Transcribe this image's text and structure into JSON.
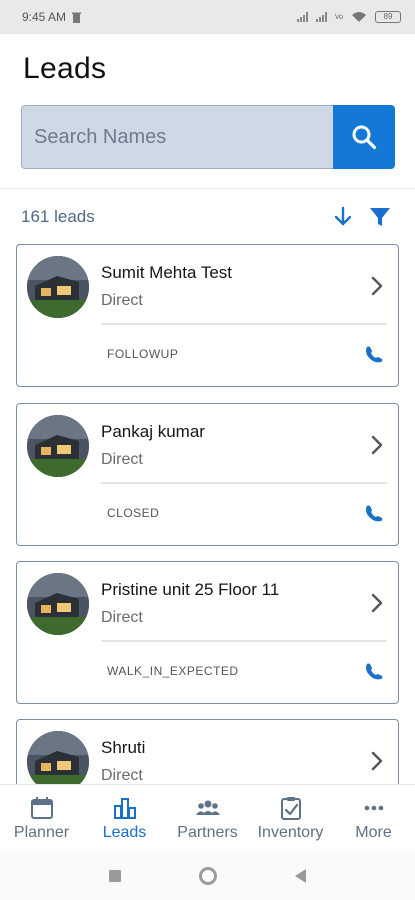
{
  "status_bar": {
    "time": "9:45 AM",
    "network_label": "Vo",
    "battery": "89"
  },
  "header": {
    "title": "Leads"
  },
  "search": {
    "placeholder": "Search Names",
    "icon": "search-icon"
  },
  "toolbar": {
    "lead_count": "161 leads",
    "sort_icon": "sort-down-arrow-icon",
    "filter_icon": "filter-funnel-icon"
  },
  "leads": [
    {
      "name": "Sumit Mehta Test",
      "source": "Direct",
      "status": "FOLLOWUP"
    },
    {
      "name": "Pankaj kumar",
      "source": "Direct",
      "status": "CLOSED"
    },
    {
      "name": "Pristine unit 25 Floor 11",
      "source": "Direct",
      "status": "WALK_IN_EXPECTED"
    },
    {
      "name": "Shruti",
      "source": "Direct",
      "status": ""
    }
  ],
  "bottom_nav": [
    {
      "label": "Planner",
      "icon": "calendar-icon",
      "active": false
    },
    {
      "label": "Leads",
      "icon": "bar-chart-icon",
      "active": true
    },
    {
      "label": "Partners",
      "icon": "group-icon",
      "active": false
    },
    {
      "label": "Inventory",
      "icon": "clipboard-check-icon",
      "active": false
    },
    {
      "label": "More",
      "icon": "more-dots-icon",
      "active": false
    }
  ],
  "colors": {
    "accent": "#1479d6",
    "search_bg": "#cfd9e6",
    "nav_inactive": "#5d7187",
    "card_border": "#7a8ea6"
  }
}
